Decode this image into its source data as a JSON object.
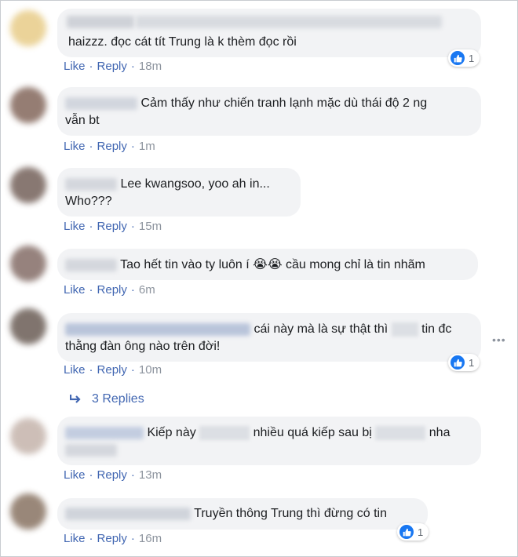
{
  "colors": {
    "link": "#4267b2",
    "bubble": "#f2f3f5",
    "like_blue": "#1877f2"
  },
  "comments": [
    {
      "text": "haizzz. đọc cát tít Trung là k thèm đọc rồi",
      "like": "Like",
      "reply": "Reply",
      "time": "18m",
      "reactions": "1"
    },
    {
      "text_line1": "Cảm thấy như chiến tranh lạnh mặc dù thái độ 2 ng",
      "text_line2": "vẫn bt",
      "like": "Like",
      "reply": "Reply",
      "time": "1m"
    },
    {
      "text_line1": "Lee kwangsoo, yoo ah in...",
      "text_line2": "Who???",
      "like": "Like",
      "reply": "Reply",
      "time": "15m"
    },
    {
      "text_a": "Tao hết tin vào ty luôn í",
      "emoji": "😭😭",
      "text_b": "cầu mong chỉ là tin nhãm",
      "like": "Like",
      "reply": "Reply",
      "time": "6m"
    },
    {
      "text_a": "cái này mà là sự thật thì",
      "text_b": "tin đc",
      "text_line2": "thằng đàn ông nào trên đời!",
      "like": "Like",
      "reply": "Reply",
      "time": "10m",
      "reactions": "1"
    },
    {
      "text_a": "Kiếp này",
      "text_b": "nhiều quá kiếp sau bị",
      "text_c": "nha",
      "like": "Like",
      "reply": "Reply",
      "time": "13m"
    },
    {
      "text": "Truyền thông Trung thì đừng có tin",
      "like": "Like",
      "reply": "Reply",
      "time": "16m",
      "reactions": "1"
    }
  ],
  "replies_link": "3 Replies",
  "separator": "·",
  "more_icon": "more-horizontal-icon"
}
